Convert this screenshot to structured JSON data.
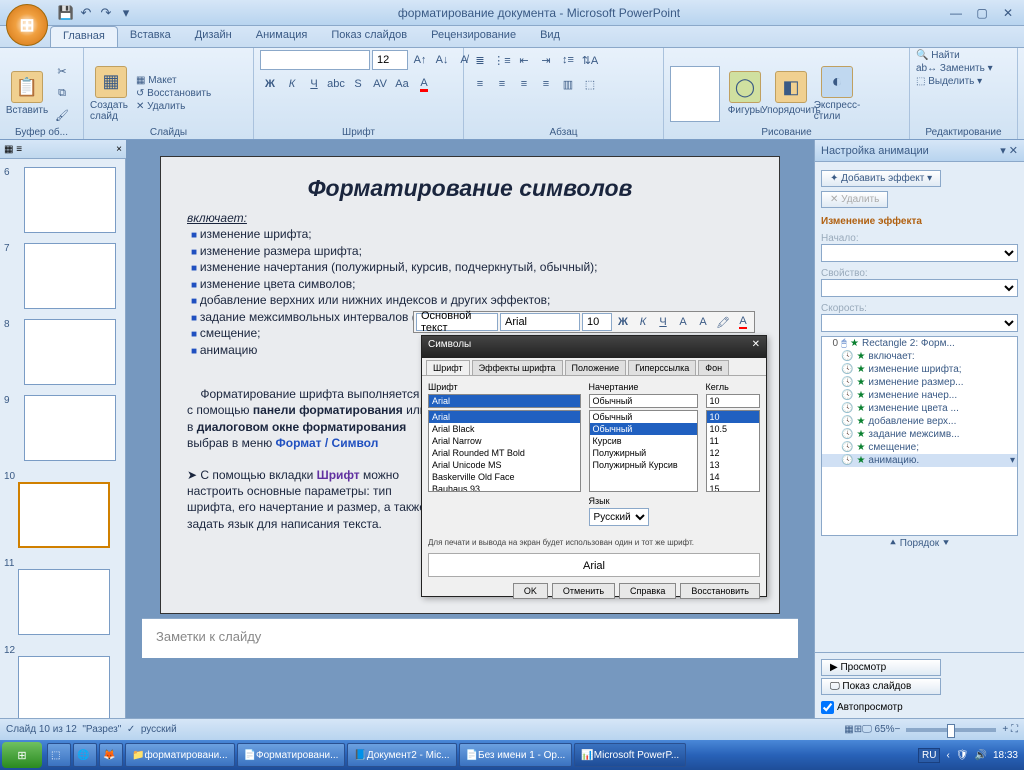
{
  "title": "форматирование документа - Microsoft PowerPoint",
  "qat": {
    "save": "💾",
    "undo": "↶",
    "redo": "↷"
  },
  "tabs": [
    "Главная",
    "Вставка",
    "Дизайн",
    "Анимация",
    "Показ слайдов",
    "Рецензирование",
    "Вид"
  ],
  "ribbon": {
    "clipboard": {
      "label": "Буфер об...",
      "paste": "Вставить"
    },
    "slides": {
      "label": "Слайды",
      "new": "Создать слайд",
      "layout": "Макет",
      "reset": "Восстановить",
      "delete": "Удалить"
    },
    "font": {
      "label": "Шрифт",
      "family": "",
      "size": "12"
    },
    "para": {
      "label": "Абзац"
    },
    "drawing": {
      "label": "Рисование",
      "shapes": "Фигуры",
      "arrange": "Упорядочить",
      "styles": "Экспресс-стили"
    },
    "editing": {
      "label": "Редактирование",
      "find": "Найти",
      "replace": "Заменить",
      "select": "Выделить"
    }
  },
  "thumbs": {
    "outline": "",
    "slides": "",
    "close": "×",
    "list": [
      {
        "n": "6"
      },
      {
        "n": "7"
      },
      {
        "n": "8"
      },
      {
        "n": "9"
      },
      {
        "n": "10"
      },
      {
        "n": "11"
      },
      {
        "n": "12"
      }
    ]
  },
  "slide": {
    "title": "Форматирование символов",
    "lead": "включает:",
    "bullets": [
      "изменение шрифта;",
      "изменение размера шрифта;",
      "изменение начертания (полужирный, курсив, подчеркнутый, обычный);",
      "изменение цвета символов;",
      "добавление верхних или нижних индексов и других эффектов;",
      "задание межсимвольных интервалов (разреженный или уплотненный);",
      "смещение;",
      "анимацию"
    ],
    "p1a": "Форматирование шрифта выполняется с помощью ",
    "p1b": "панели форматирования",
    "p1c": "    или в ",
    "p1d": "диалоговом окне форматирования",
    "p1e": " выбрав в меню ",
    "p1f": "Формат / Символ",
    "p2a": "➤   С помощью вкладки ",
    "p2b": "Шрифт",
    "p2c": " можно настроить основные параметры: тип шрифта, его начертание и размер, а также задать язык для написания текста."
  },
  "mini": {
    "font_box": "Основной текст",
    "font_name": "Arial",
    "size": "10"
  },
  "dialog": {
    "title": "Символы",
    "tabs": [
      "Шрифт",
      "Эффекты шрифта",
      "Положение",
      "Гиперссылка",
      "Фон"
    ],
    "col_font": "Шрифт",
    "col_style": "Начертание",
    "col_size": "Кегль",
    "font_val": "Arial",
    "fonts": [
      "Arial",
      "Arial Black",
      "Arial Narrow",
      "Arial Rounded MT Bold",
      "Arial Unicode MS",
      "Baskerville Old Face",
      "Bauhaus 93"
    ],
    "style_val": "Обычный",
    "styles": [
      "Обычный",
      "Обычный",
      "Курсив",
      "Полужирный",
      "Полужирный Курсив"
    ],
    "size_val": "10",
    "sizes": [
      "10",
      "10.5",
      "11",
      "12",
      "13",
      "14",
      "15"
    ],
    "lang_label": "Язык",
    "lang": "Русский",
    "note": "Для печати и вывода на экран будет использован один и тот же шрифт.",
    "preview": "Arial",
    "btns": [
      "OK",
      "Отменить",
      "Справка",
      "Восстановить"
    ]
  },
  "anim": {
    "title": "Настройка анимации",
    "add": "Добавить эффект",
    "remove": "Удалить",
    "change": "Изменение эффекта",
    "start": "Начало:",
    "prop": "Свойство:",
    "speed": "Скорость:",
    "items": [
      {
        "o": "0",
        "n": "Rectangle 2: Форм..."
      },
      {
        "o": "",
        "n": "включает:"
      },
      {
        "o": "",
        "n": "изменение шрифта;"
      },
      {
        "o": "",
        "n": "изменение размер..."
      },
      {
        "o": "",
        "n": "изменение начер..."
      },
      {
        "o": "",
        "n": "изменение цвета ..."
      },
      {
        "o": "",
        "n": "добавление верх..."
      },
      {
        "o": "",
        "n": "задание межсимв..."
      },
      {
        "o": "",
        "n": "смещение;"
      },
      {
        "o": "",
        "n": "анимацию."
      }
    ],
    "order": "Порядок",
    "play": "Просмотр",
    "show": "Показ слайдов",
    "auto": "Автопросмотр"
  },
  "notes": "Заметки к слайду",
  "status": {
    "slide": "Слайд 10 из 12",
    "theme": "\"Разрез\"",
    "lang": "русский",
    "zoom": "65%"
  },
  "taskbar": {
    "items": [
      "форматировани...",
      "Форматировани...",
      "Документ2 - Mic...",
      "Без имени 1 - Op...",
      "Microsoft PowerP..."
    ],
    "lang": "RU",
    "time": "18:33"
  }
}
